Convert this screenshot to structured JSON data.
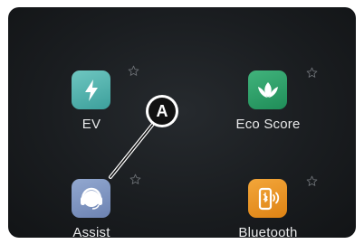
{
  "apps": [
    {
      "label": "EV",
      "icon": "lightning-bolt-icon",
      "color": "#4fb3ad",
      "favorite": false
    },
    {
      "label": "Eco Score",
      "icon": "leaf-icon",
      "color": "#2da36a",
      "favorite": false
    },
    {
      "label": "Assist",
      "icon": "headset-icon",
      "color": "#7f95c2",
      "favorite": false
    },
    {
      "label": "Bluetooth",
      "icon": "phone-audio-icon",
      "color": "#e99325",
      "favorite": false
    }
  ],
  "callout": {
    "letter": "A",
    "target": "Assist"
  },
  "colors": {
    "screen_background": "#1c1f22",
    "label_text": "#e9eaeb",
    "star_outline": "#6c7075"
  }
}
